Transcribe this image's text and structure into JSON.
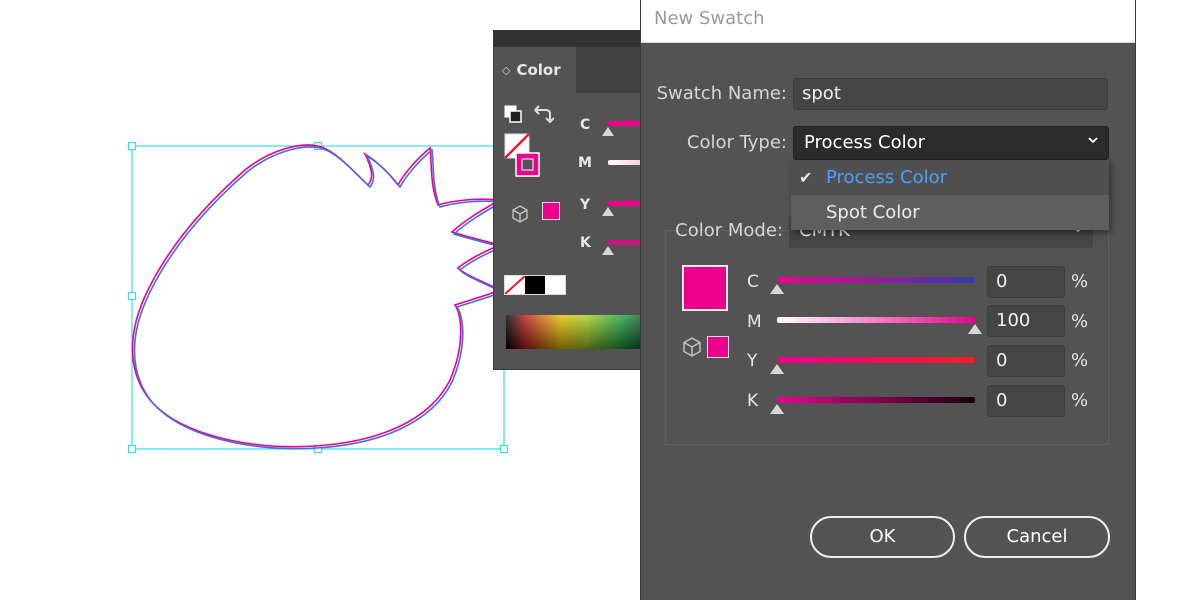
{
  "colors": {
    "accent_magenta": "#ec008c",
    "bounding_box": "#33e0ea",
    "selected_item_text": "#4aa0ff",
    "panel_bg": "#535353"
  },
  "color_panel": {
    "tab_label": "Color",
    "icons": [
      "swap-fill-stroke-icon",
      "default-fill-stroke-icon",
      "cube-icon",
      "none-swatch-icon"
    ],
    "channels": [
      {
        "label": "C"
      },
      {
        "label": "M"
      },
      {
        "label": "Y"
      },
      {
        "label": "K"
      }
    ]
  },
  "dialog": {
    "title": "New Swatch",
    "swatch_name_label": "Swatch Name:",
    "swatch_name_value": "spot",
    "color_type_label": "Color Type:",
    "color_type_value": "Process Color",
    "color_type_options": [
      {
        "label": "Process Color",
        "selected": true
      },
      {
        "label": "Spot Color",
        "selected": false
      }
    ],
    "color_mode_label": "Color Mode:",
    "color_mode_value": "CMYK",
    "channels": [
      {
        "label": "C",
        "value": "0",
        "unit": "%",
        "level": 0
      },
      {
        "label": "M",
        "value": "100",
        "unit": "%",
        "level": 1
      },
      {
        "label": "Y",
        "value": "0",
        "unit": "%",
        "level": 0
      },
      {
        "label": "K",
        "value": "0",
        "unit": "%",
        "level": 0
      }
    ],
    "ok_label": "OK",
    "cancel_label": "Cancel"
  }
}
